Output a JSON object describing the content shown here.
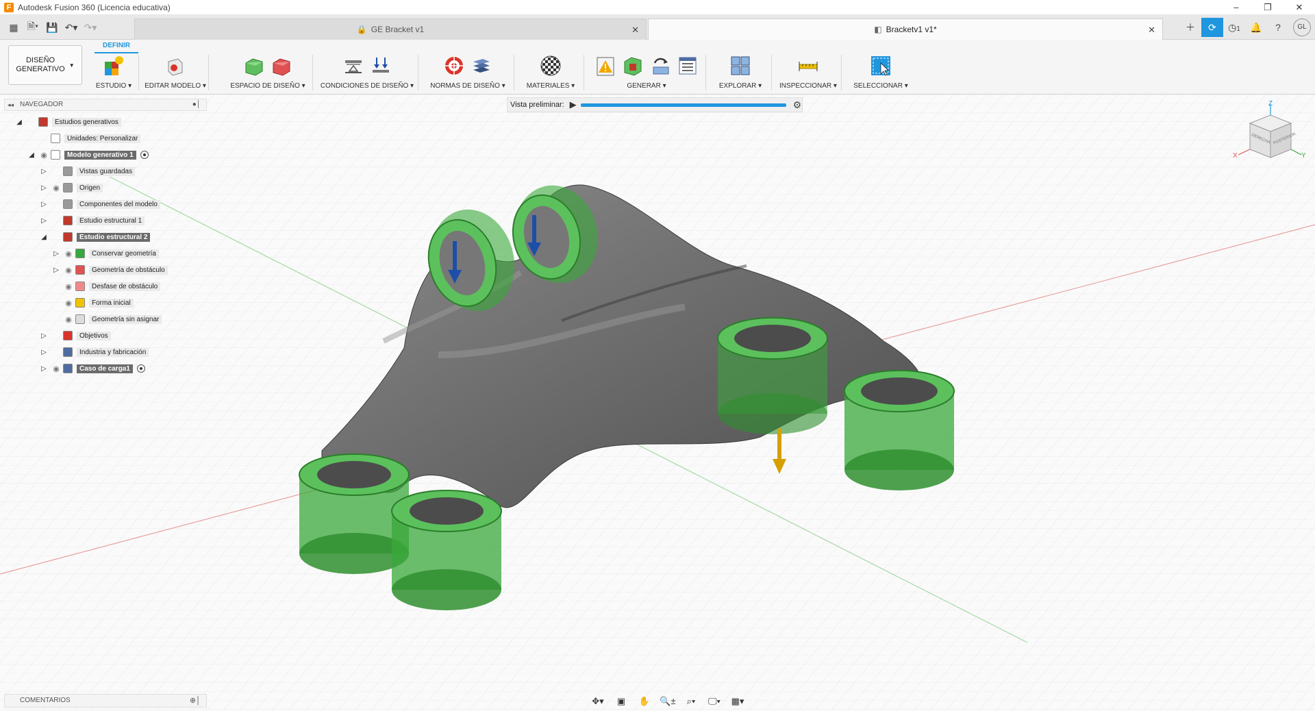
{
  "window": {
    "title": "Autodesk Fusion 360 (Licencia educativa)",
    "app_icon": "F",
    "controls": [
      "–",
      "❐",
      "✕"
    ]
  },
  "tabs": [
    {
      "label": "GE Bracket v1",
      "active": false,
      "icon": "lock-icon"
    },
    {
      "label": "Bracketv1 v1*",
      "active": true,
      "icon": "box-icon"
    }
  ],
  "quick_access": [
    "grid-menu-icon",
    "file-icon",
    "save-icon",
    "undo-icon",
    "redo-icon"
  ],
  "right_controls": {
    "badge_count": "1",
    "avatar": "GL"
  },
  "workspace": {
    "label": "DISEÑO GENERATIVO",
    "line1": "DISEÑO",
    "line2": "GENERATIVO"
  },
  "ribbon_tab": "DEFINIR",
  "ribbon_groups": [
    {
      "label": "ESTUDIO ▾",
      "icons": [
        "study-icon"
      ]
    },
    {
      "label": "EDITAR MODELO ▾",
      "icons": [
        "edit-model-icon"
      ]
    },
    {
      "label": "ESPACIO DE DISEÑO ▾",
      "icons": [
        "preserve-geometry-icon",
        "obstacle-geometry-icon"
      ]
    },
    {
      "label": "CONDICIONES DE DISEÑO ▾",
      "icons": [
        "structural-constraint-icon",
        "structural-load-icon"
      ]
    },
    {
      "label": "NORMAS DE DISEÑO ▾",
      "icons": [
        "objectives-icon",
        "manufacturing-icon"
      ]
    },
    {
      "label": "MATERIALES ▾",
      "icons": [
        "materials-icon"
      ]
    },
    {
      "label": "GENERAR ▾",
      "icons": [
        "precheck-icon",
        "preview-icon",
        "generate-icon",
        "settings-icon"
      ]
    },
    {
      "label": "EXPLORAR ▾",
      "icons": [
        "explore-icon"
      ]
    },
    {
      "label": "INSPECCIONAR ▾",
      "icons": [
        "measure-icon"
      ]
    },
    {
      "label": "SELECCIONAR ▾",
      "icons": [
        "select-icon"
      ]
    }
  ],
  "browser": {
    "title": "NAVEGADOR",
    "nodes": [
      {
        "label": "Estudios generativos",
        "level": 0,
        "toggle": "◢",
        "eye": false,
        "icon": "#c0392b",
        "selected": false,
        "radio": false
      },
      {
        "label": "Unidades: Personalizar",
        "level": 1,
        "toggle": "",
        "eye": false,
        "icon": "#ffffff",
        "selected": false,
        "radio": false
      },
      {
        "label": "Modelo generativo 1",
        "level": 1,
        "toggle": "◢",
        "eye": true,
        "icon": "#ffffff",
        "selected": true,
        "radio": true
      },
      {
        "label": "Vistas guardadas",
        "level": 2,
        "toggle": "▷",
        "eye": false,
        "icon": "#9a9a9a",
        "selected": false,
        "radio": false
      },
      {
        "label": "Origen",
        "level": 2,
        "toggle": "▷",
        "eye": true,
        "icon": "#9a9a9a",
        "selected": false,
        "radio": false
      },
      {
        "label": "Componentes del modelo",
        "level": 2,
        "toggle": "▷",
        "eye": false,
        "icon": "#9a9a9a",
        "selected": false,
        "radio": false
      },
      {
        "label": "Estudio estructural 1",
        "level": 2,
        "toggle": "▷",
        "eye": false,
        "icon": "#c0392b",
        "selected": false,
        "radio": false
      },
      {
        "label": "Estudio estructural 2",
        "level": 2,
        "toggle": "◢",
        "eye": false,
        "icon": "#c0392b",
        "selected": true,
        "radio": false
      },
      {
        "label": "Conservar geometría",
        "level": 3,
        "toggle": "▷",
        "eye": true,
        "icon": "#37a83c",
        "selected": false,
        "radio": false
      },
      {
        "label": "Geometría de obstáculo",
        "level": 3,
        "toggle": "▷",
        "eye": true,
        "icon": "#e05252",
        "selected": false,
        "radio": false
      },
      {
        "label": "Desfase de obstáculo",
        "level": 3,
        "toggle": "",
        "eye": true,
        "icon": "#f08a8a",
        "selected": false,
        "radio": false
      },
      {
        "label": "Forma inicial",
        "level": 3,
        "toggle": "",
        "eye": true,
        "icon": "#f2c200",
        "selected": false,
        "radio": false
      },
      {
        "label": "Geometría sin asignar",
        "level": 3,
        "toggle": "",
        "eye": true,
        "icon": "#dcdcdc",
        "selected": false,
        "radio": false
      },
      {
        "label": "Objetivos",
        "level": 2,
        "toggle": "▷",
        "eye": false,
        "icon": "#d9342b",
        "selected": false,
        "radio": false
      },
      {
        "label": "Industria y fabricación",
        "level": 2,
        "toggle": "▷",
        "eye": false,
        "icon": "#4f6c9e",
        "selected": false,
        "radio": false
      },
      {
        "label": "Caso de carga1",
        "level": 2,
        "toggle": "▷",
        "eye": true,
        "icon": "#4f6c9e",
        "selected": true,
        "radio": true
      }
    ]
  },
  "preview": {
    "label": "Vista preliminar:",
    "progress": 1.0
  },
  "viewcube": {
    "faces": [
      "DERECHA",
      "POSTERIOR"
    ],
    "axes": [
      "X",
      "Y",
      "Z"
    ]
  },
  "comments": {
    "title": "COMENTARIOS"
  },
  "nav_toolbar": [
    "orbit-icon",
    "look-at-icon",
    "pan-icon",
    "zoom-icon",
    "fit-icon",
    "display-settings-icon",
    "grid-settings-icon"
  ],
  "colors": {
    "accent": "#1f96de",
    "preserve": "#3aa83a",
    "body": "#6b6b6b",
    "load_arrow": "#1d4fa8",
    "gravity_arrow": "#d5a000"
  }
}
